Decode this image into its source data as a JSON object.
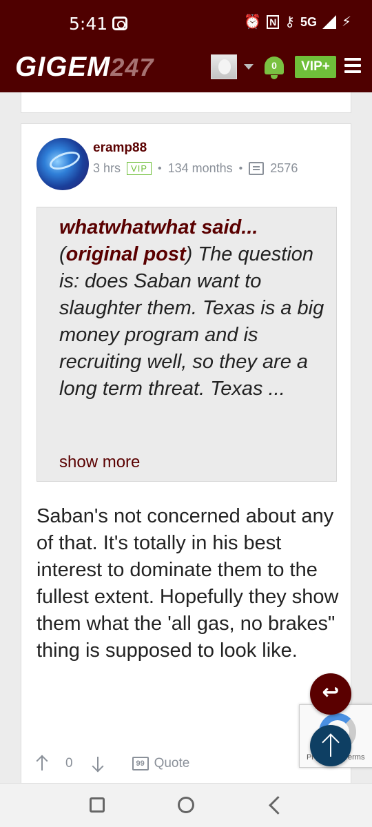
{
  "status_bar": {
    "time": "5:41",
    "network": "5G",
    "icons": [
      "camera-icon",
      "alarm-icon",
      "nfc-icon",
      "key-icon",
      "signal-icon",
      "charging-icon"
    ]
  },
  "header": {
    "logo_main": "GIGEM",
    "logo_num": "247",
    "notification_count": "0",
    "vip_label": "VIP+"
  },
  "post": {
    "username": "eramp88",
    "time": "3 hrs",
    "badge": "VIP",
    "tenure": "134 months",
    "post_count": "2576",
    "quote": {
      "author": "whatwhatwhat said...",
      "original_label": "original post",
      "text": "The question is: does Saban want to slaughter them. Texas is a big money program and is recruiting well, so they are a long term threat. Texas ...",
      "show_more": "show more"
    },
    "body": "Saban's not concerned about any of that. It's totally in his best interest to dominate them to the fullest extent. Hopefully they show them what the 'all gas, no brakes\" thing is supposed to look like.",
    "votes": "0",
    "quote_label": "Quote"
  },
  "recaptcha": {
    "text_left": "Pr",
    "text_right": "erms"
  },
  "colors": {
    "brand": "#4f0000",
    "accent_green": "#6fbf3a",
    "fab_blue": "#0e3f63"
  }
}
